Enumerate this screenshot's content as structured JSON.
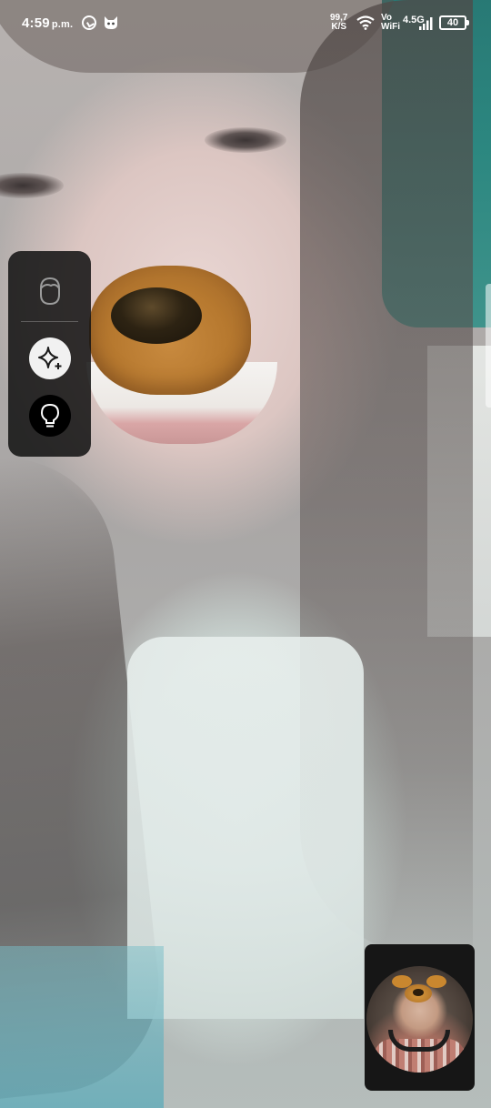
{
  "status_bar": {
    "time": "4:59",
    "ampm": "p.m.",
    "network_speed_value": "99,7",
    "network_speed_unit": "K/S",
    "vowifi_line1": "Vo",
    "vowifi_line2": "WiFi",
    "network_type": "4.5G",
    "battery": "40",
    "icons": [
      "whatsapp-icon",
      "cat-icon",
      "wifi-icon",
      "signal-icon",
      "battery-icon"
    ]
  },
  "effects_panel": {
    "items": [
      "avatar-icon",
      "sparkle-effects-icon",
      "lightbulb-icon"
    ]
  },
  "colors": {
    "panel_bg": "#121212",
    "effects_button_bg": "#f1f1f1",
    "lighting_button_bg": "#000000",
    "status_text": "#ffffff"
  }
}
